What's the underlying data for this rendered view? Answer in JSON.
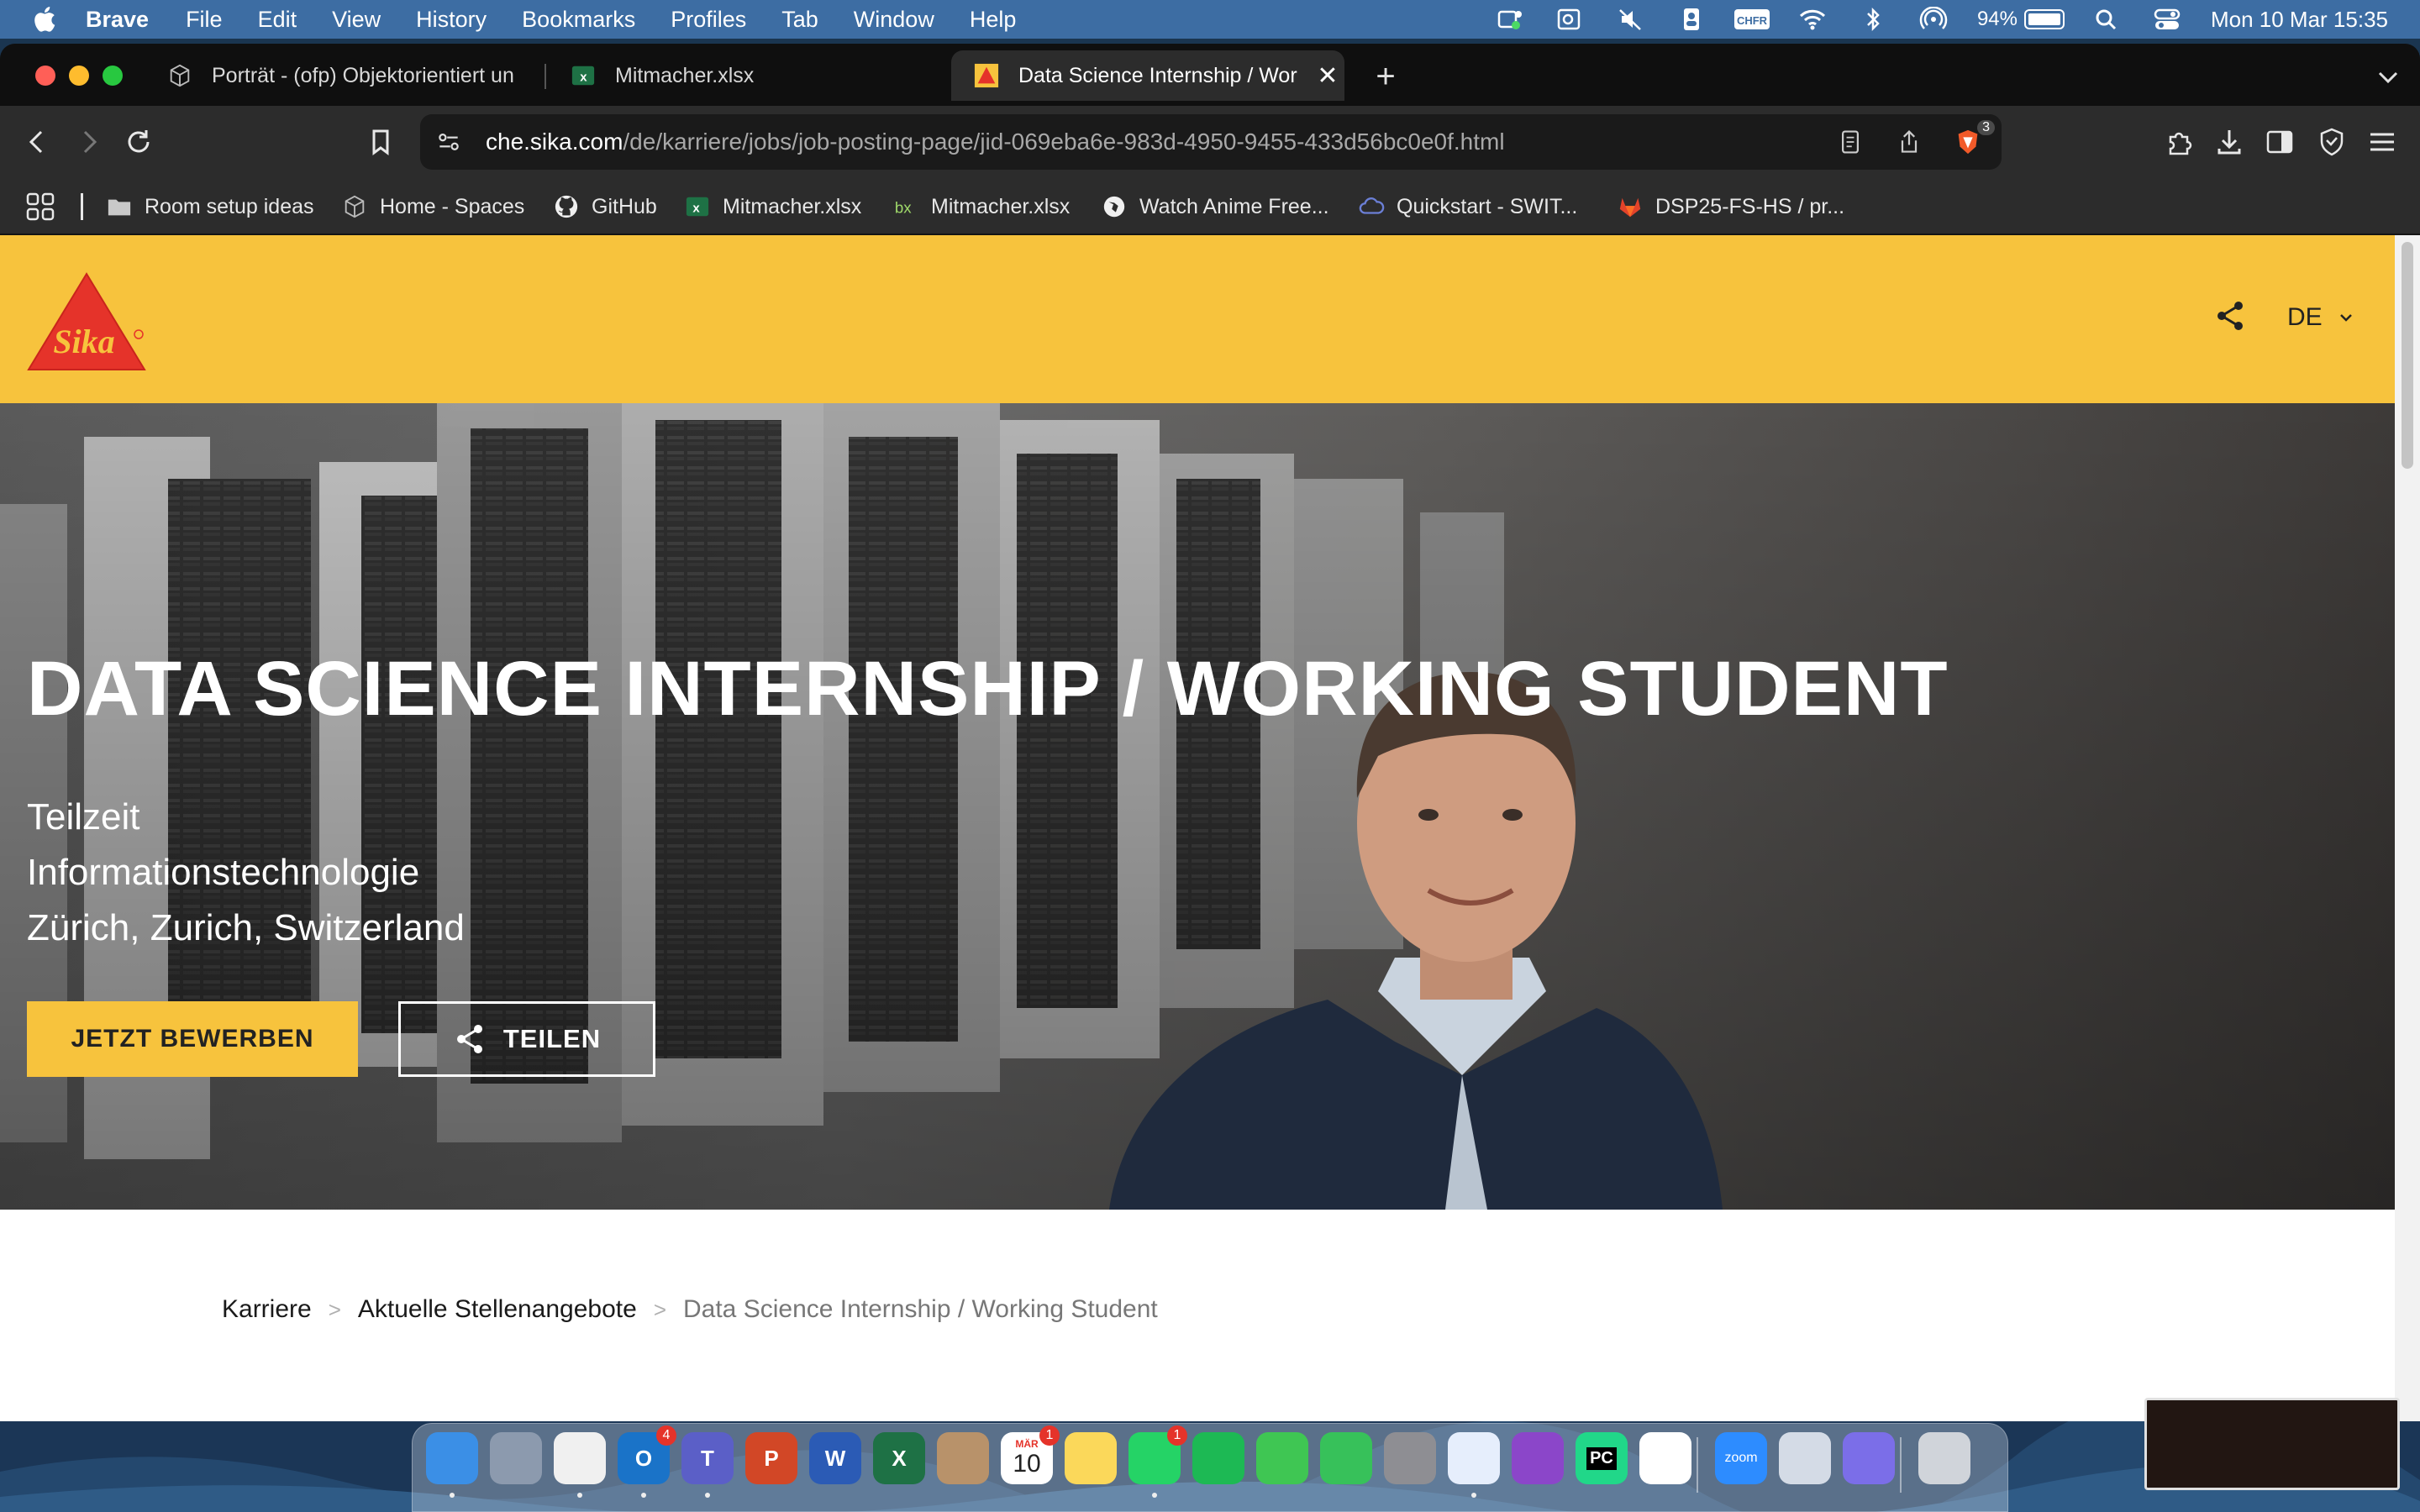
{
  "menubar": {
    "app_name": "Brave",
    "items": [
      "File",
      "Edit",
      "View",
      "History",
      "Bookmarks",
      "Profiles",
      "Tab",
      "Window",
      "Help"
    ],
    "battery_percent": "94%",
    "battery_level": 0.94,
    "datetime": "Mon 10 Mar  15:35",
    "status_icons": [
      "teams-status-icon",
      "outlook-status-icon",
      "mute-icon",
      "contacts-icon",
      "chfr-icon",
      "wifi-icon",
      "bluetooth-icon",
      "airdrop-icon",
      "battery-icon",
      "spotlight-icon",
      "control-center-icon"
    ],
    "status_chfr": "CHFR"
  },
  "tabs": [
    {
      "label": "Porträt - (ofp) Objektorientiert un",
      "icon": "notion-icon",
      "active": false
    },
    {
      "label": "Mitmacher.xlsx",
      "icon": "excel-icon",
      "active": false
    },
    {
      "label": "Data Science Internship / Wor",
      "icon": "sika-icon",
      "active": true
    }
  ],
  "address_bar": {
    "host": "che.sika.com",
    "path": "/de/karriere/jobs/job-posting-page/jid-069eba6e-983d-4950-9455-433d56bc0e0f.html",
    "shields_count": "3"
  },
  "bookmarks": [
    {
      "label": "Room setup ideas",
      "icon": "folder-icon"
    },
    {
      "label": "Home - Spaces",
      "icon": "notion-icon"
    },
    {
      "label": "GitHub",
      "icon": "github-icon"
    },
    {
      "label": "Mitmacher.xlsx",
      "icon": "excel-icon"
    },
    {
      "label": "Mitmacher.xlsx",
      "icon": "bx-icon"
    },
    {
      "label": "Watch Anime Free...",
      "icon": "globe-icon"
    },
    {
      "label": "Quickstart - SWIT...",
      "icon": "cloud-icon"
    },
    {
      "label": "DSP25-FS-HS / pr...",
      "icon": "gitlab-icon"
    }
  ],
  "page": {
    "brand": {
      "logo_text": "Sika",
      "yellow": "#f7c33d",
      "red": "#e5332a"
    },
    "language": "DE",
    "hero": {
      "title": "DATA SCIENCE INTERNSHIP / WORKING STUDENT",
      "employment_type": "Teilzeit",
      "department": "Informationstechnologie",
      "location": "Zürich, Zurich, Switzerland",
      "apply_label": "JETZT BEWERBEN",
      "share_label": "TEILEN"
    },
    "breadcrumb": {
      "items": [
        "Karriere",
        "Aktuelle Stellenangebote"
      ],
      "separator": ">",
      "current": "Data Science Internship / Working Student"
    }
  },
  "dock": {
    "apps": [
      {
        "name": "finder",
        "icon": "finder-icon",
        "color": "#3b8fe6",
        "glyph": "",
        "badge": ""
      },
      {
        "name": "launchpad",
        "icon": "launchpad-icon",
        "color": "#8c9aae",
        "glyph": "",
        "badge": ""
      },
      {
        "name": "brave",
        "icon": "brave-icon",
        "color": "#f0f0f0",
        "glyph": "",
        "badge": ""
      },
      {
        "name": "outlook",
        "icon": "outlook-icon",
        "color": "#1a73c8",
        "glyph": "O",
        "badge": "4"
      },
      {
        "name": "teams",
        "icon": "teams-icon",
        "color": "#5b5fc7",
        "glyph": "T",
        "badge": ""
      },
      {
        "name": "powerpoint",
        "icon": "powerpoint-icon",
        "color": "#d24726",
        "glyph": "P",
        "badge": ""
      },
      {
        "name": "word",
        "icon": "word-icon",
        "color": "#2b5bb5",
        "glyph": "W",
        "badge": ""
      },
      {
        "name": "excel",
        "icon": "excel-icon",
        "color": "#1e7145",
        "glyph": "X",
        "badge": ""
      },
      {
        "name": "contacts",
        "icon": "contacts-icon",
        "color": "#b8926a",
        "glyph": "",
        "badge": ""
      },
      {
        "name": "calendar",
        "icon": "calendar-icon",
        "color": "#ffffff",
        "glyph": "10",
        "badge": "1",
        "month": "MÄR"
      },
      {
        "name": "notes",
        "icon": "notes-icon",
        "color": "#fbd85a",
        "glyph": "",
        "badge": ""
      },
      {
        "name": "whatsapp",
        "icon": "whatsapp-icon",
        "color": "#25d366",
        "glyph": "",
        "badge": "1"
      },
      {
        "name": "spotify",
        "icon": "spotify-icon",
        "color": "#1db954",
        "glyph": "",
        "badge": ""
      },
      {
        "name": "messages",
        "icon": "messages-icon",
        "color": "#3fc653",
        "glyph": "",
        "badge": ""
      },
      {
        "name": "facetime",
        "icon": "facetime-icon",
        "color": "#37c15a",
        "glyph": "",
        "badge": ""
      },
      {
        "name": "system-settings",
        "icon": "settings-icon",
        "color": "#8e8e93",
        "glyph": "",
        "badge": ""
      },
      {
        "name": "paw",
        "icon": "paw-icon",
        "color": "#e6eefc",
        "glyph": "",
        "badge": ""
      },
      {
        "name": "github-desktop",
        "icon": "github-icon",
        "color": "#8b46c9",
        "glyph": "",
        "badge": ""
      },
      {
        "name": "pycharm",
        "icon": "pycharm-icon",
        "color": "#21d789",
        "glyph": "PC",
        "badge": ""
      },
      {
        "name": "vscode",
        "icon": "vscode-icon",
        "color": "#ffffff",
        "glyph": "",
        "badge": ""
      },
      {
        "name": "zoom",
        "icon": "zoom-icon",
        "color": "#2d8cff",
        "glyph": "zoom",
        "badge": ""
      },
      {
        "name": "preview",
        "icon": "preview-icon",
        "color": "#d4dbe6",
        "glyph": "",
        "badge": ""
      },
      {
        "name": "readwise",
        "icon": "reader-icon",
        "color": "#7b6ee8",
        "glyph": "",
        "badge": ""
      },
      {
        "name": "trash",
        "icon": "trash-icon",
        "color": "#d0d4da",
        "glyph": "",
        "badge": ""
      }
    ]
  }
}
